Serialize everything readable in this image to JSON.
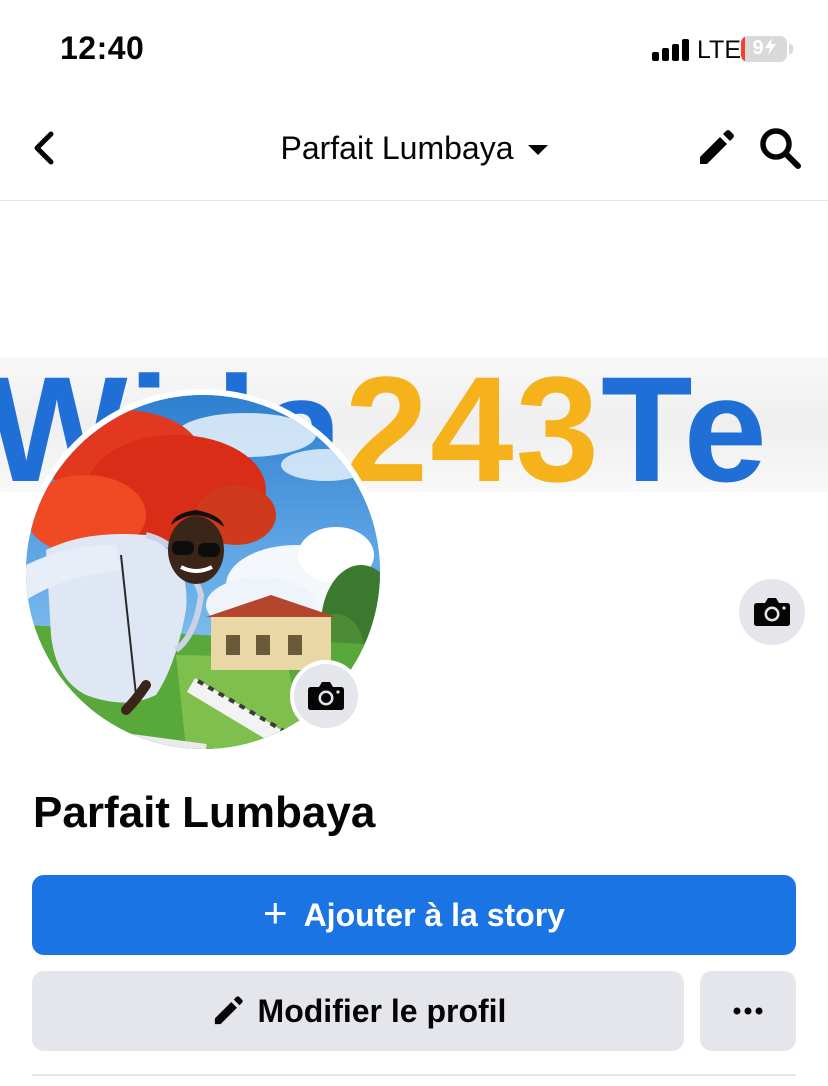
{
  "status_bar": {
    "time": "12:40",
    "network": "LTE",
    "battery_level": "9",
    "battery_color": "#ff3b30",
    "signal_bars": 4
  },
  "nav": {
    "back_icon": "chevron-left-icon",
    "title": "Parfait Lumbaya",
    "caret_icon": "caret-down-icon",
    "edit_icon": "pencil-icon",
    "search_icon": "search-icon"
  },
  "cover": {
    "text_part1": "Wi  la",
    "text_part2": "243",
    "text_part3": "Te",
    "camera_icon": "camera-icon",
    "blue": "#1f6fd6",
    "yellow": "#f6b21a"
  },
  "profile": {
    "name": "Parfait Lumbaya",
    "avatar_camera_icon": "camera-icon"
  },
  "actions": {
    "add_story_plus": "+",
    "add_story_label": "Ajouter à la story",
    "edit_profile_label": "Modifier le profil",
    "more_icon": "more-horizontal-icon",
    "primary_color": "#1b74e4",
    "secondary_color": "#e4e6eb"
  }
}
